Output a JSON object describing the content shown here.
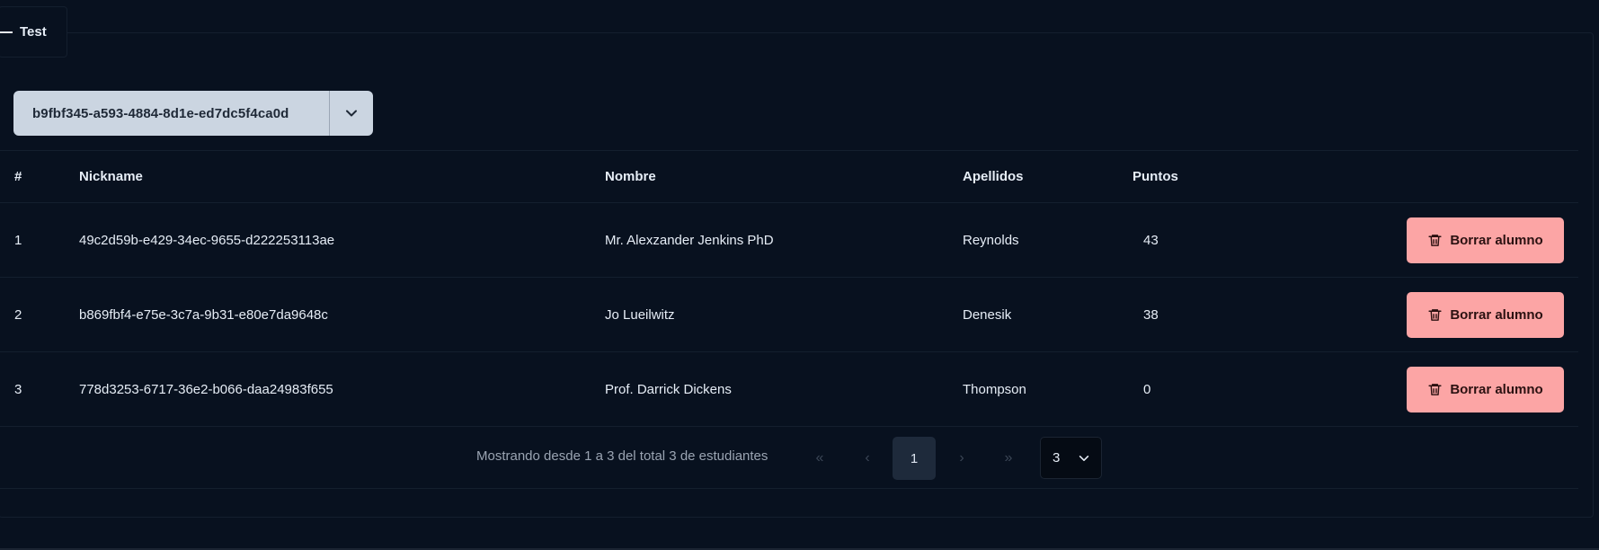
{
  "panel": {
    "legend": "Test"
  },
  "selector": {
    "value": "b9fbf345-a593-4884-8d1e-ed7dc5f4ca0d"
  },
  "table": {
    "columns": [
      "#",
      "Nickname",
      "Nombre",
      "Apellidos",
      "Puntos"
    ],
    "rows": [
      {
        "index": "1",
        "nickname": "49c2d59b-e429-34ec-9655-d222253113ae",
        "nombre": "Mr. Alexzander Jenkins PhD",
        "apellidos": "Reynolds",
        "puntos": "43",
        "action": "Borrar alumno"
      },
      {
        "index": "2",
        "nickname": "b869fbf4-e75e-3c7a-9b31-e80e7da9648c",
        "nombre": "Jo Lueilwitz",
        "apellidos": "Denesik",
        "puntos": "38",
        "action": "Borrar alumno"
      },
      {
        "index": "3",
        "nickname": "778d3253-6717-36e2-b066-daa24983f655",
        "nombre": "Prof. Darrick Dickens",
        "apellidos": "Thompson",
        "puntos": "0",
        "action": "Borrar alumno"
      }
    ]
  },
  "pagination": {
    "info": "Mostrando desde 1 a 3 del total 3 de estudiantes",
    "first": "«",
    "prev": "‹",
    "current_page": "1",
    "next": "›",
    "last": "»",
    "per_page": "3"
  },
  "colors": {
    "background": "#08111f",
    "selector_bg": "#cbd5e1",
    "delete_button": "#fca5a5",
    "active_page": "#1e2a3b"
  },
  "icons": {
    "legend": "dash-icon",
    "selector_toggle": "chevron-down-icon",
    "delete": "trash-icon",
    "per_page_toggle": "chevron-down-icon"
  }
}
